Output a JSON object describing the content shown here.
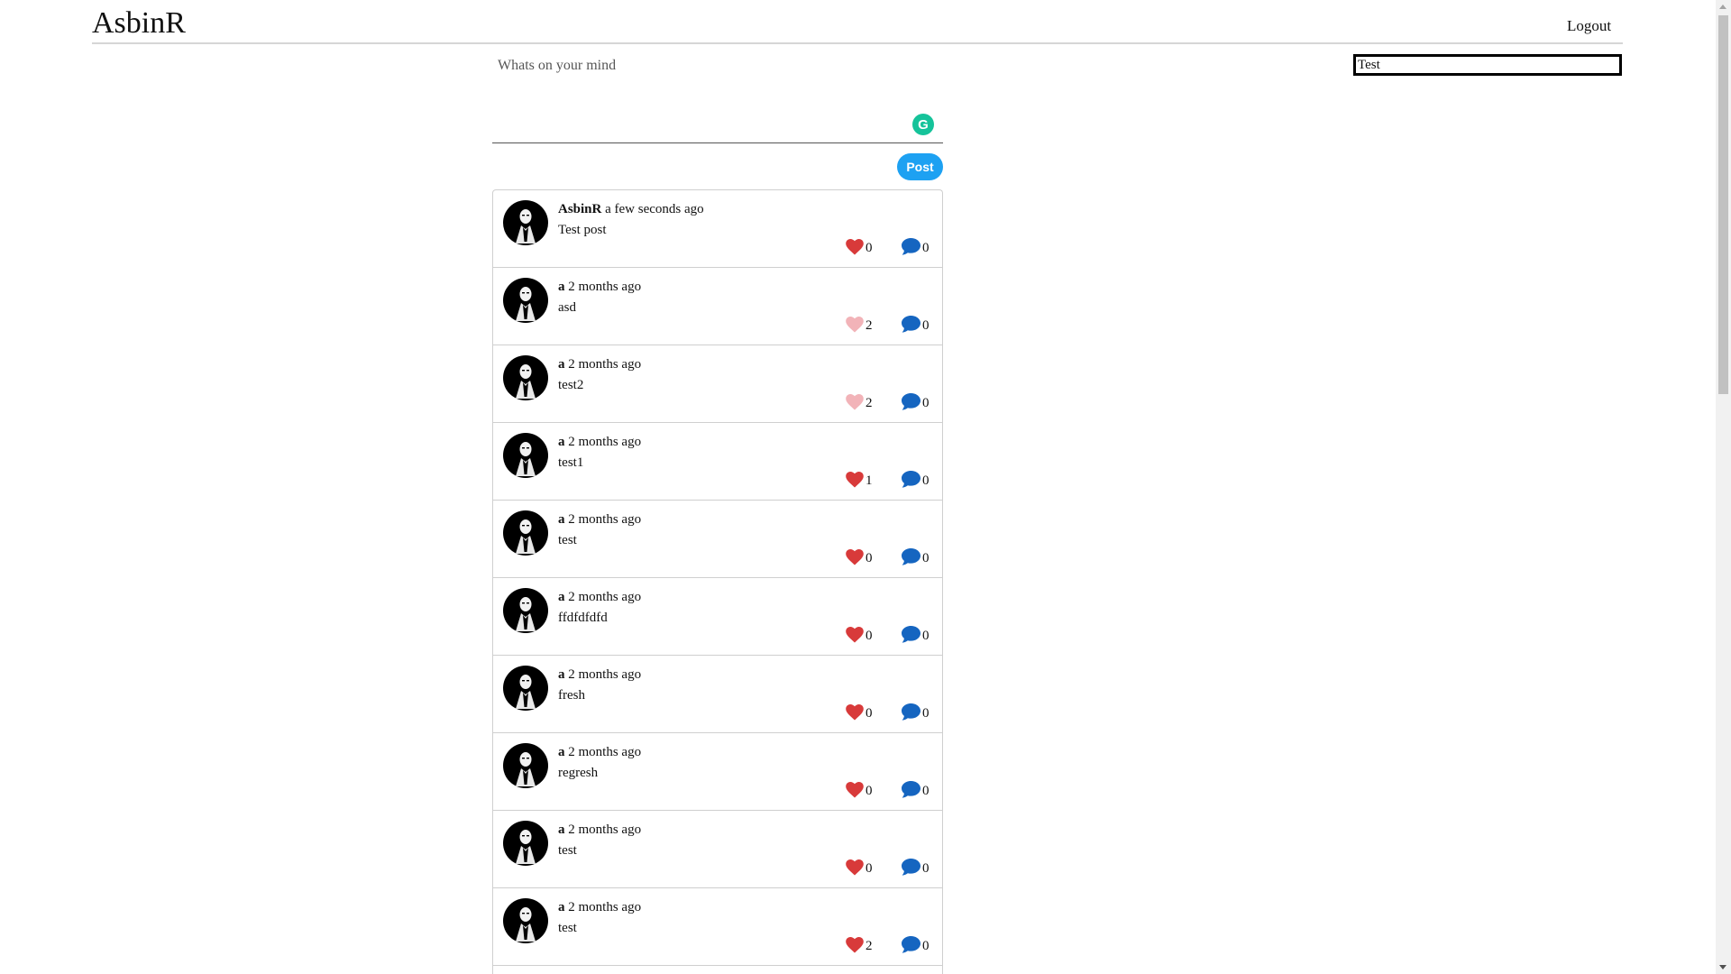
{
  "header": {
    "brand": "AsbinR",
    "logout_label": "Logout",
    "search_value": "Test"
  },
  "composer": {
    "label": "Whats on your mind",
    "grammarly_glyph": "G",
    "post_label": "Post"
  },
  "colors": {
    "like_active": "#d83a3a",
    "like_liked": "#f2b3b8",
    "comment": "#1565c0",
    "post_button": "#1da1f2",
    "grammarly": "#15c39a"
  },
  "posts": [
    {
      "user": "AsbinR",
      "time": "a few seconds ago",
      "content": "Test post",
      "likes": "0",
      "comments": "0",
      "liked": false
    },
    {
      "user": "a",
      "time": "2 months ago",
      "content": "asd",
      "likes": "2",
      "comments": "0",
      "liked": true
    },
    {
      "user": "a",
      "time": "2 months ago",
      "content": "test2",
      "likes": "2",
      "comments": "0",
      "liked": true
    },
    {
      "user": "a",
      "time": "2 months ago",
      "content": "test1",
      "likes": "1",
      "comments": "0",
      "liked": false
    },
    {
      "user": "a",
      "time": "2 months ago",
      "content": "test",
      "likes": "0",
      "comments": "0",
      "liked": false
    },
    {
      "user": "a",
      "time": "2 months ago",
      "content": "ffdfdfdfd",
      "likes": "0",
      "comments": "0",
      "liked": false
    },
    {
      "user": "a",
      "time": "2 months ago",
      "content": "fresh",
      "likes": "0",
      "comments": "0",
      "liked": false
    },
    {
      "user": "a",
      "time": "2 months ago",
      "content": "regresh",
      "likes": "0",
      "comments": "0",
      "liked": false
    },
    {
      "user": "a",
      "time": "2 months ago",
      "content": "test",
      "likes": "0",
      "comments": "0",
      "liked": false
    },
    {
      "user": "a",
      "time": "2 months ago",
      "content": "test",
      "likes": "2",
      "comments": "0",
      "liked": false
    }
  ]
}
